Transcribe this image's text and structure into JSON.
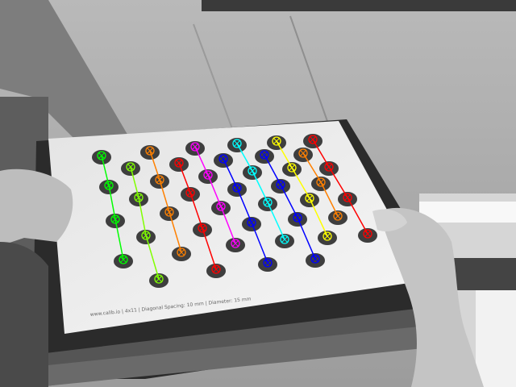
{
  "board": {
    "caption": "www.calib.io | 4x11 | Diagonal Spacing: 10 mm | Diameter: 15 mm"
  },
  "detection": {
    "marker_colors": [
      "#ff0000",
      "#ff8000",
      "#ffff00",
      "#80ff00",
      "#00ff00",
      "#00ffff",
      "#0000ff",
      "#ff00ff"
    ],
    "connection_style": "colored polyline through detected circle centers, one color per grid column"
  },
  "icons": {
    "circle_marker": "crosshair-circle-icon"
  }
}
